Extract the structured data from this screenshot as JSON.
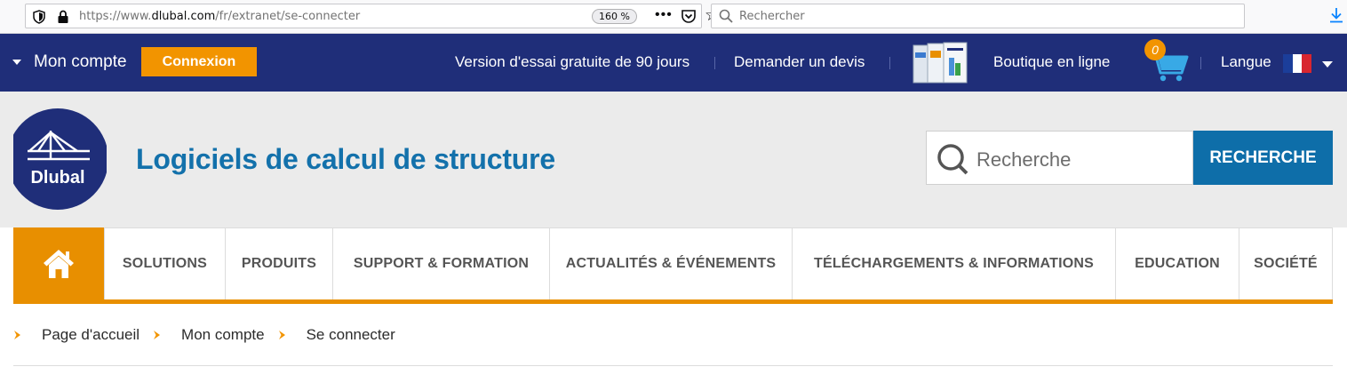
{
  "browser": {
    "url_prefix": "https://www.",
    "url_host": "dlubal.com",
    "url_path": "/fr/extranet/se-connecter",
    "zoom": "160 %",
    "more": "•••",
    "search_placeholder": "Rechercher",
    "icons": [
      "shield-icon",
      "lock-icon",
      "pocket-icon",
      "star-icon",
      "search-icon",
      "download-icon"
    ]
  },
  "topbar": {
    "account_label": "Mon compte",
    "login_button": "Connexion",
    "links": [
      "Version d'essai gratuite de 90 jours",
      "Demander un devis",
      "Boutique en ligne"
    ],
    "cart_count": "0",
    "language_label": "Langue",
    "colors": {
      "bar": "#1f2e79",
      "accent": "#f29400"
    }
  },
  "header": {
    "logo_text": "Dlubal",
    "tagline": "Logiciels de calcul de structure",
    "search_placeholder": "Recherche",
    "search_button": "RECHERCHE",
    "colors": {
      "tagline": "#1371ab",
      "search_button": "#0e6ea9"
    }
  },
  "nav": {
    "home_icon": "home-icon",
    "items": [
      "SOLUTIONS",
      "PRODUITS",
      "SUPPORT & FORMATION",
      "ACTUALITÉS & ÉVÉNEMENTS",
      "TÉLÉCHARGEMENTS & INFORMATIONS",
      "EDUCATION",
      "SOCIÉTÉ"
    ]
  },
  "breadcrumb": {
    "items": [
      "Page d'accueil",
      "Mon compte"
    ],
    "current": "Se connecter"
  }
}
